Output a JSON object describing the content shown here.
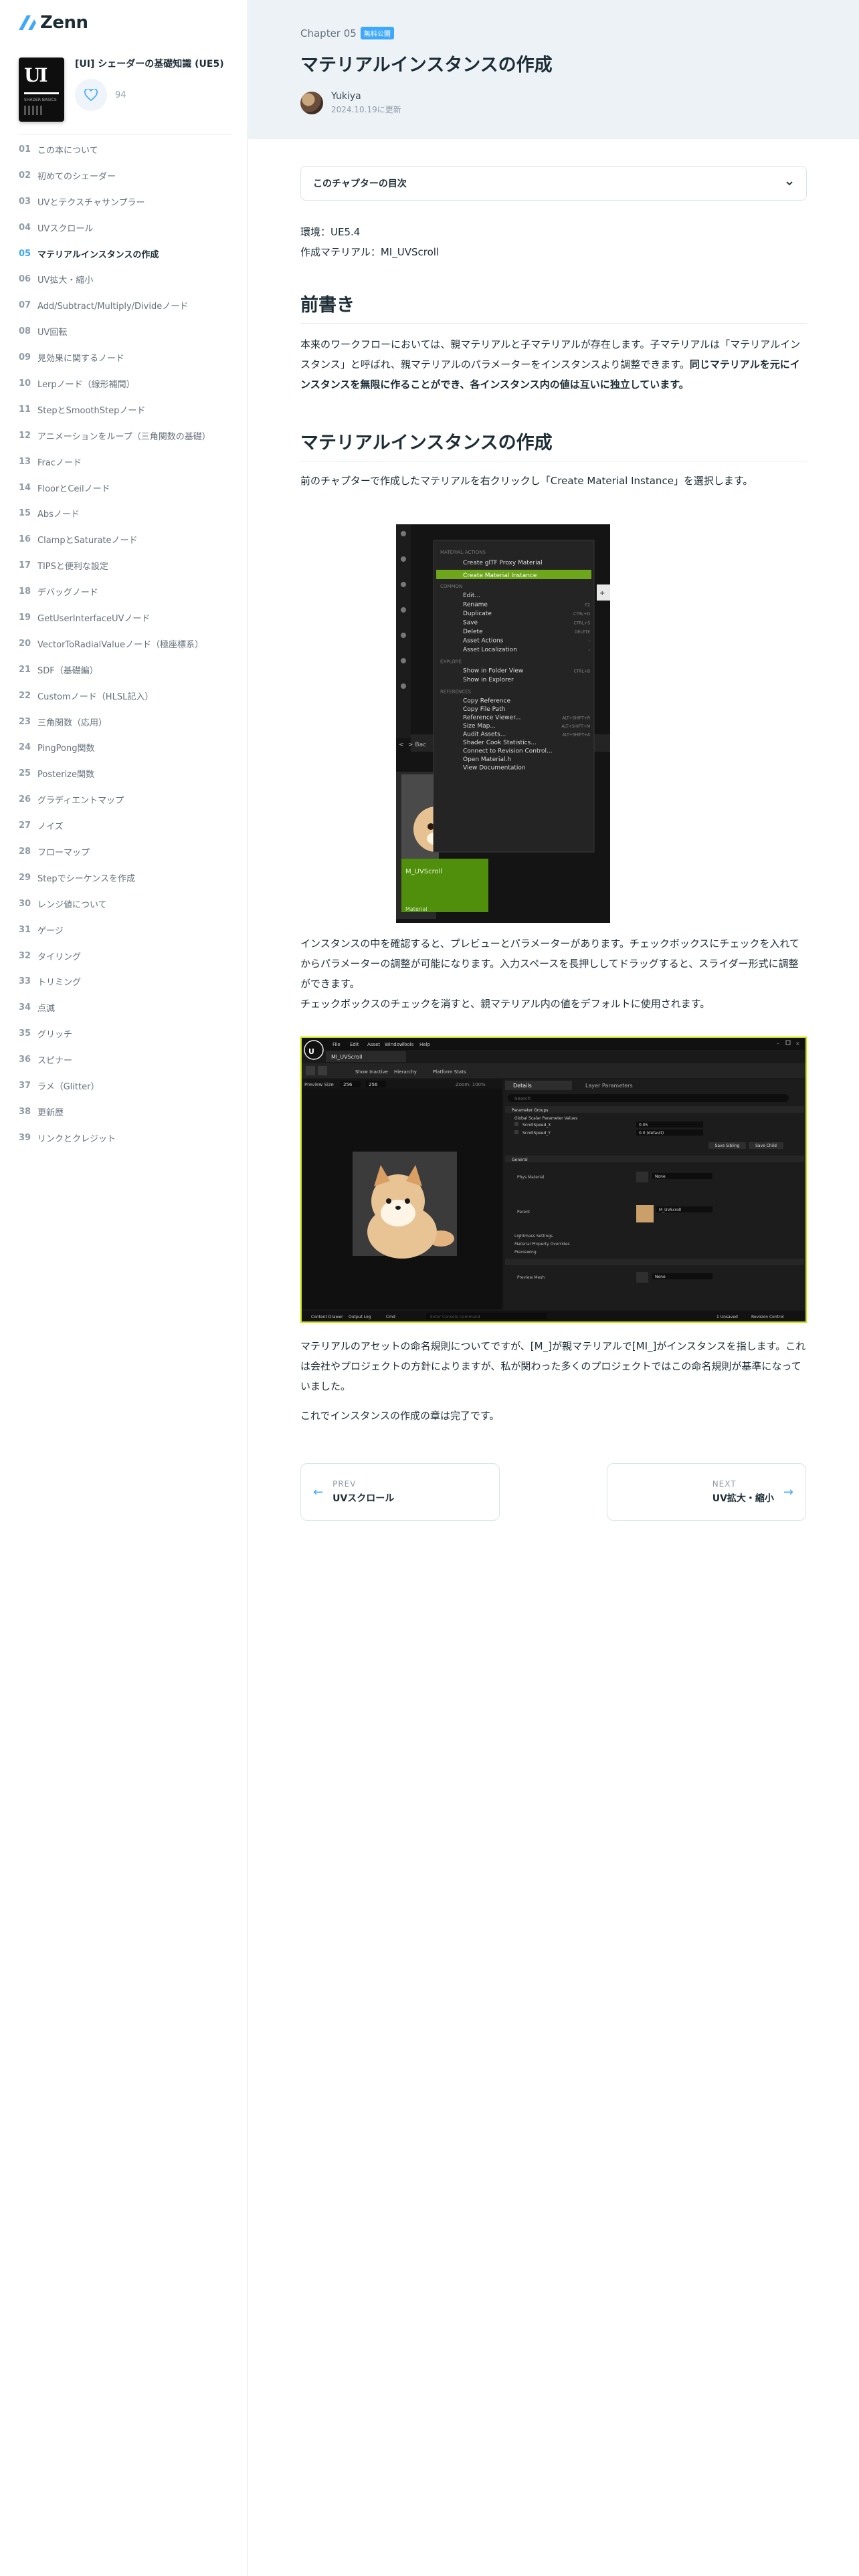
{
  "brand": {
    "logo_text": "Zenn",
    "accent": "#3ea8ff"
  },
  "book": {
    "title": "[UI] シェーダーの基礎知識 (UE5)",
    "cover_text": "UI",
    "cover_subtext": "SHADER BASICS",
    "like_count": "94"
  },
  "toc": [
    {
      "num": "01",
      "label": "この本について"
    },
    {
      "num": "02",
      "label": "初めてのシェーダー"
    },
    {
      "num": "03",
      "label": "UVとテクスチャサンプラー"
    },
    {
      "num": "04",
      "label": "UVスクロール"
    },
    {
      "num": "05",
      "label": "マテリアルインスタンスの作成",
      "active": true
    },
    {
      "num": "06",
      "label": "UV拡大・縮小"
    },
    {
      "num": "07",
      "label": "Add/Subtract/Multiply/Divideノード"
    },
    {
      "num": "08",
      "label": "UV回転"
    },
    {
      "num": "09",
      "label": "見効果に関するノード"
    },
    {
      "num": "10",
      "label": "Lerpノード（線形補間）"
    },
    {
      "num": "11",
      "label": "StepとSmoothStepノード"
    },
    {
      "num": "12",
      "label": "アニメーションをループ（三角関数の基礎）"
    },
    {
      "num": "13",
      "label": "Fracノード"
    },
    {
      "num": "14",
      "label": "FloorとCeilノード"
    },
    {
      "num": "15",
      "label": "Absノード"
    },
    {
      "num": "16",
      "label": "ClampとSaturateノード"
    },
    {
      "num": "17",
      "label": "TIPSと便利な設定"
    },
    {
      "num": "18",
      "label": "デバッグノード"
    },
    {
      "num": "19",
      "label": "GetUserInterfaceUVノード"
    },
    {
      "num": "20",
      "label": "VectorToRadialValueノード（極座標系）"
    },
    {
      "num": "21",
      "label": "SDF（基礎編）"
    },
    {
      "num": "22",
      "label": "Customノード（HLSL記入）"
    },
    {
      "num": "23",
      "label": "三角関数（応用）"
    },
    {
      "num": "24",
      "label": "PingPong関数"
    },
    {
      "num": "25",
      "label": "Posterize関数"
    },
    {
      "num": "26",
      "label": "グラディエントマップ"
    },
    {
      "num": "27",
      "label": "ノイズ"
    },
    {
      "num": "28",
      "label": "フローマップ"
    },
    {
      "num": "29",
      "label": "Stepでシーケンスを作成"
    },
    {
      "num": "30",
      "label": "レンジ値について"
    },
    {
      "num": "31",
      "label": "ゲージ"
    },
    {
      "num": "32",
      "label": "タイリング"
    },
    {
      "num": "33",
      "label": "トリミング"
    },
    {
      "num": "34",
      "label": "点滅"
    },
    {
      "num": "35",
      "label": "グリッチ"
    },
    {
      "num": "36",
      "label": "スピナー"
    },
    {
      "num": "37",
      "label": "ラメ（Glitter）"
    },
    {
      "num": "38",
      "label": "更新歴"
    },
    {
      "num": "39",
      "label": "リンクとクレジット"
    }
  ],
  "header": {
    "chapter": "Chapter 05",
    "badge": "無料公開",
    "title": "マテリアルインスタンスの作成",
    "author": "Yukiya",
    "date": "2024.10.19に更新"
  },
  "content": {
    "toc_box_label": "このチャプターの目次",
    "env_line1": "環境：UE5.4",
    "env_line2": "作成マテリアル：MI_UVScroll",
    "h_intro": "前書き",
    "intro_p_a": "本来のワークフローにおいては、親マテリアルと子マテリアルが存在します。子マテリアルは「マテリアルインスタンス」と呼ばれ、親マテリアルのパラメーターをインスタンスより調整できます。",
    "intro_p_b": "同じマテリアルを元にインスタンスを無限に作ることができ、各インスタンス内の値は互いに独立しています。",
    "h_create": "マテリアルインスタンスの作成",
    "create_p": "前のチャプターで作成したマテリアルを右クリックし「Create Material Instance」を選択します。",
    "after_shot1_p1": "インスタンスの中を確認すると、プレビューとパラメーターがあります。チェックボックスにチェックを入れてからパラメーターの調整が可能になります。入力スペースを長押ししてドラッグすると、スライダー形式に調整ができます。",
    "after_shot1_p2": "チェックボックスのチェックを消すと、親マテリアル内の値をデフォルトに使用されます。",
    "naming_p": "マテリアルのアセットの命名規則についてですが、[M_]が親マテリアルで[MI_]がインスタンスを指します。これは会社やプロジェクトの方針によりますが、私が関わった多くのプロジェクトではこの命名規則が基準になっていました。",
    "done_p": "これでインスタンスの作成の章は完了です。"
  },
  "context_menu": {
    "section1": "MATERIAL ACTIONS",
    "item_gltf": "Create glTF Proxy Material",
    "item_instance": "Create Material Instance",
    "section2": "COMMON",
    "items_common": [
      {
        "label": "Edit...",
        "shortcut": ""
      },
      {
        "label": "Rename",
        "shortcut": "F2"
      },
      {
        "label": "Duplicate",
        "shortcut": "CTRL+D"
      },
      {
        "label": "Save",
        "shortcut": "CTRL+S"
      },
      {
        "label": "Delete",
        "shortcut": "DELETE"
      },
      {
        "label": "Asset Actions",
        "shortcut": "›"
      },
      {
        "label": "Asset Localization",
        "shortcut": "›"
      }
    ],
    "section3": "EXPLORE",
    "items_explore": [
      {
        "label": "Show in Folder View",
        "shortcut": "CTRL+B"
      },
      {
        "label": "Show in Explorer",
        "shortcut": ""
      }
    ],
    "section4": "REFERENCES",
    "items_refs": [
      {
        "label": "Copy Reference",
        "shortcut": ""
      },
      {
        "label": "Copy File Path",
        "shortcut": ""
      },
      {
        "label": "Reference Viewer...",
        "shortcut": "ALT+SHIFT+R"
      },
      {
        "label": "Size Map...",
        "shortcut": "ALT+SHIFT+M"
      },
      {
        "label": "Audit Assets...",
        "shortcut": "ALT+SHIFT+A"
      },
      {
        "label": "Shader Cook Statistics...",
        "shortcut": ""
      },
      {
        "label": "Connect to Revision Control...",
        "shortcut": ""
      },
      {
        "label": "Open Material.h",
        "shortcut": ""
      },
      {
        "label": "View Documentation",
        "shortcut": ""
      }
    ],
    "asset_name": "M_UVScroll",
    "asset_type": "Material"
  },
  "editor": {
    "menu": [
      "File",
      "Edit",
      "Asset",
      "Window",
      "Tools",
      "Help"
    ],
    "tab": "MI_UVScroll",
    "toolbar": [
      "Show Inactive",
      "Hierarchy",
      "Platform Stats"
    ],
    "preview_size_label": "Preview Size",
    "preview_w": "256",
    "preview_h": "256",
    "zoom_label": "Zoom: 100%",
    "details_tab": "Details",
    "layer_tab": "Layer Parameters",
    "search_placeholder": "Search",
    "groups": [
      "Parameter Groups",
      "Global Scalar Parameter Values"
    ],
    "params": [
      {
        "name": "ScrollSpeed_X",
        "value": "0.05"
      },
      {
        "name": "ScrollSpeed_Y",
        "value": "0.0 (default)"
      }
    ],
    "save_sibling": "Save Sibling",
    "save_child": "Save Child",
    "general": "General",
    "phys_material": "Phys Material",
    "none": "None",
    "parent": "Parent",
    "parent_value": "M_UVScroll",
    "lightmass": "Lightmass Settings",
    "material_properties": "Material Property Overrides",
    "preview": "Previewing",
    "preview_mesh": "Preview Mesh",
    "bottom": [
      "Content Drawer",
      "Output Log",
      "Cmd"
    ],
    "console_placeholder": "Enter Console Command",
    "status": [
      "1 Unsaved",
      "Revision Control"
    ]
  },
  "nav": {
    "prev_label": "PREV",
    "prev_title": "UVスクロール",
    "next_label": "NEXT",
    "next_title": "UV拡大・縮小"
  }
}
